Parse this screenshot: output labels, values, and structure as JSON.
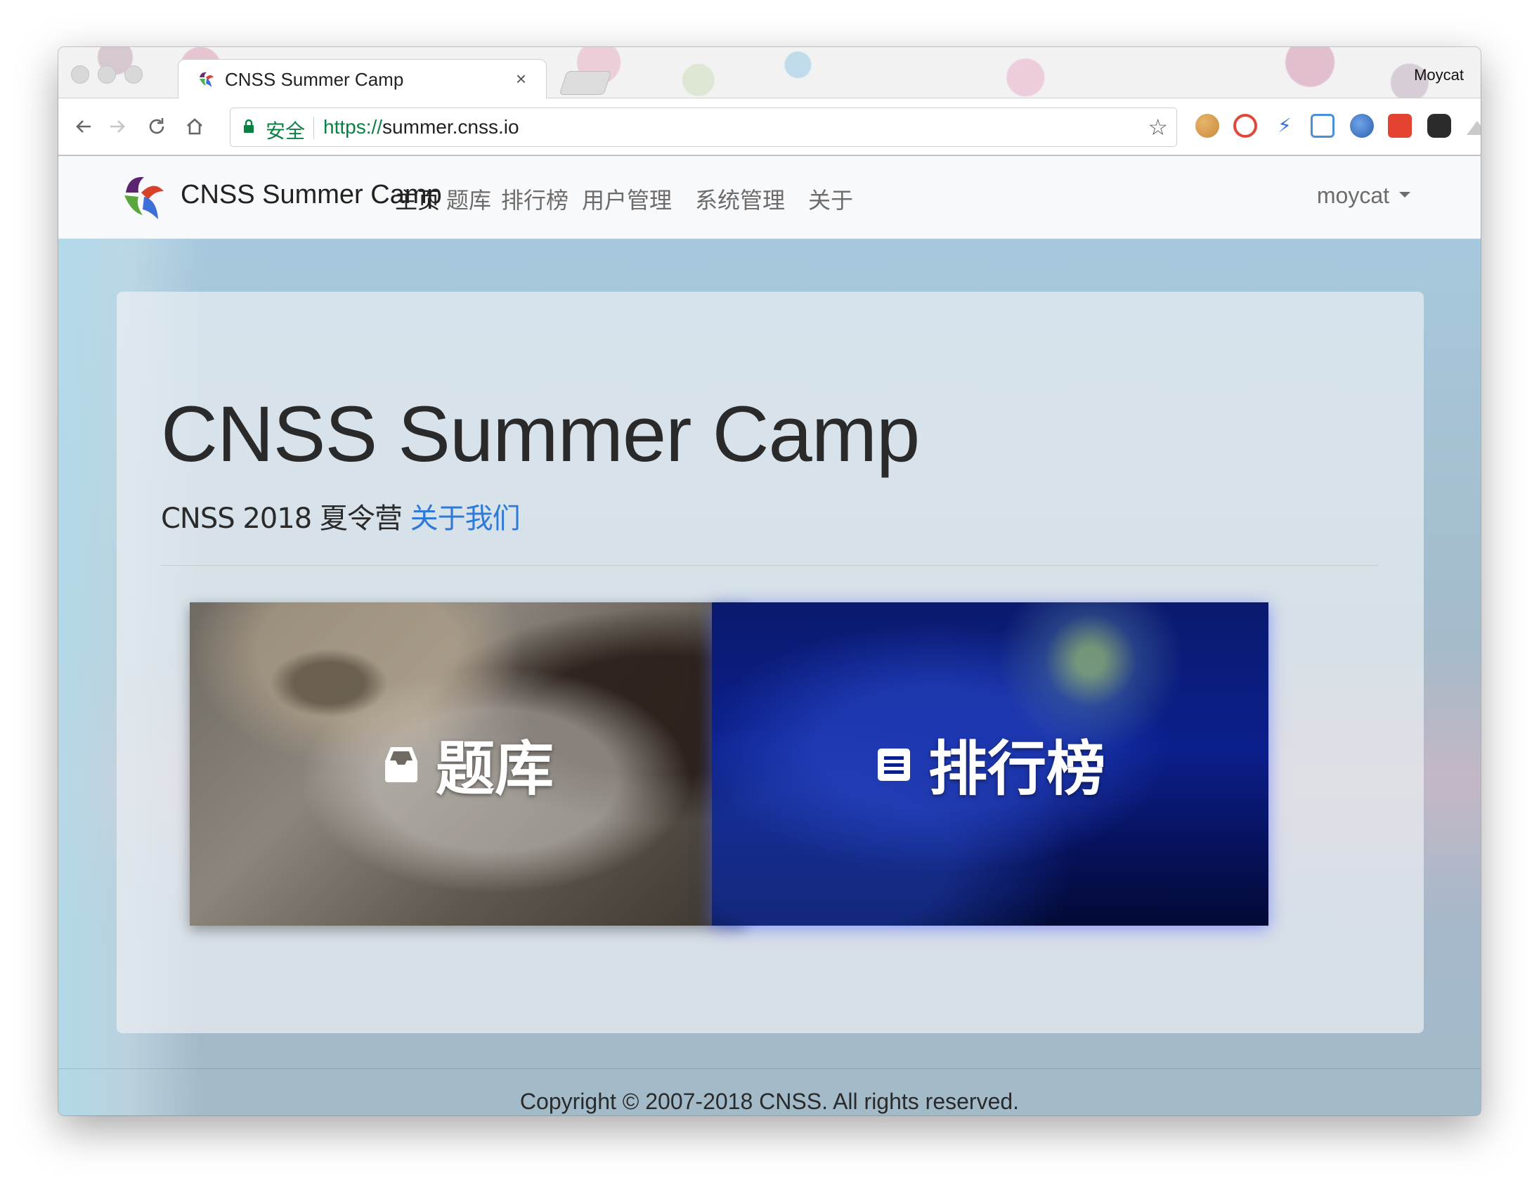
{
  "browser": {
    "tab": {
      "title": "CNSS Summer Camp",
      "close_icon": "×"
    },
    "profile_name": "Moycat",
    "omnibox": {
      "secure_label": "安全",
      "url_scheme": "https://",
      "url_host": "summer.cnss.io"
    },
    "toolbar_icons": [
      "back-icon",
      "forward-icon",
      "reload-icon",
      "home-icon",
      "star-icon"
    ],
    "extensions": [
      "cookie-extension-icon",
      "adblock-extension-icon",
      "lightning-extension-icon",
      "s-extension-icon",
      "globe-extension-icon",
      "todoist-extension-icon",
      "ghostery-extension-icon",
      "drive-extension-icon",
      "menu-icon"
    ]
  },
  "navbar": {
    "brand": "CNSS Summer Camp",
    "items": [
      {
        "label": "主页",
        "active": true
      },
      {
        "label": "题库",
        "active": false
      },
      {
        "label": "排行榜",
        "active": false
      },
      {
        "label": "用户管理",
        "active": false
      },
      {
        "label": "系统管理",
        "active": false
      },
      {
        "label": "关于",
        "active": false
      }
    ],
    "user": "moycat"
  },
  "hero": {
    "title": "CNSS Summer Camp",
    "subtitle": "CNSS 2018 夏令营",
    "link_text": "关于我们"
  },
  "cards": [
    {
      "label": "题库",
      "icon": "inbox-icon"
    },
    {
      "label": "排行榜",
      "icon": "list-icon"
    }
  ],
  "footer": {
    "copyright": "Copyright © 2007-2018 CNSS. All rights reserved."
  },
  "colors": {
    "secure_green": "#0b8043",
    "link_blue": "#2f7ad6",
    "page_background": "#a3bac8",
    "navbar_background": "#f8f9fa"
  }
}
